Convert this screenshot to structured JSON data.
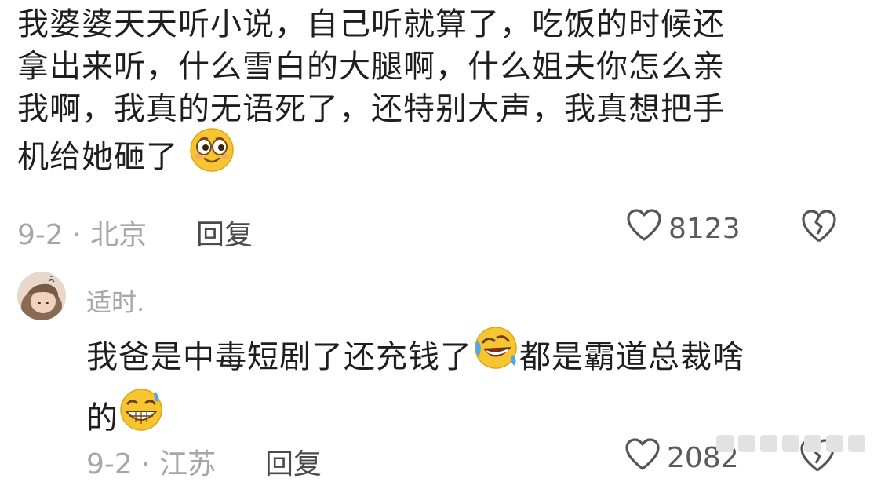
{
  "comment": {
    "lines": [
      "我婆婆天天听小说，自己听就算了，吃饭的时候还",
      "拿出来听，什么雪白的大腿啊，什么姐夫你怎么亲",
      "我啊，我真的无语死了，还特别大声，我真想把手",
      "机给她砸了"
    ],
    "emoji": "smiling-face-emoji",
    "date_location": "9-2 · 北京",
    "reply_label": "回复",
    "like_count": "8123",
    "like_icon": "heart-outline-icon",
    "dislike_icon": "broken-heart-icon"
  },
  "reply": {
    "author": "适时.",
    "avatar": "avatar-girl",
    "text_line1_part1": "我爸是中毒短剧了还充钱了",
    "text_line1_part2": "都是霸道总裁啥",
    "text_line2": "的",
    "emoji_1": "rolling-laughing-emoji",
    "emoji_2": "grinning-sweat-emoji",
    "date_location": "9-2 · 江苏",
    "reply_label": "回复",
    "like_count": "2082",
    "like_icon": "heart-outline-icon",
    "dislike_icon": "broken-heart-icon"
  },
  "colors": {
    "text": "#1e1e1e",
    "meta": "#a6a6a6",
    "emoji_yellow": "#f7c531"
  }
}
